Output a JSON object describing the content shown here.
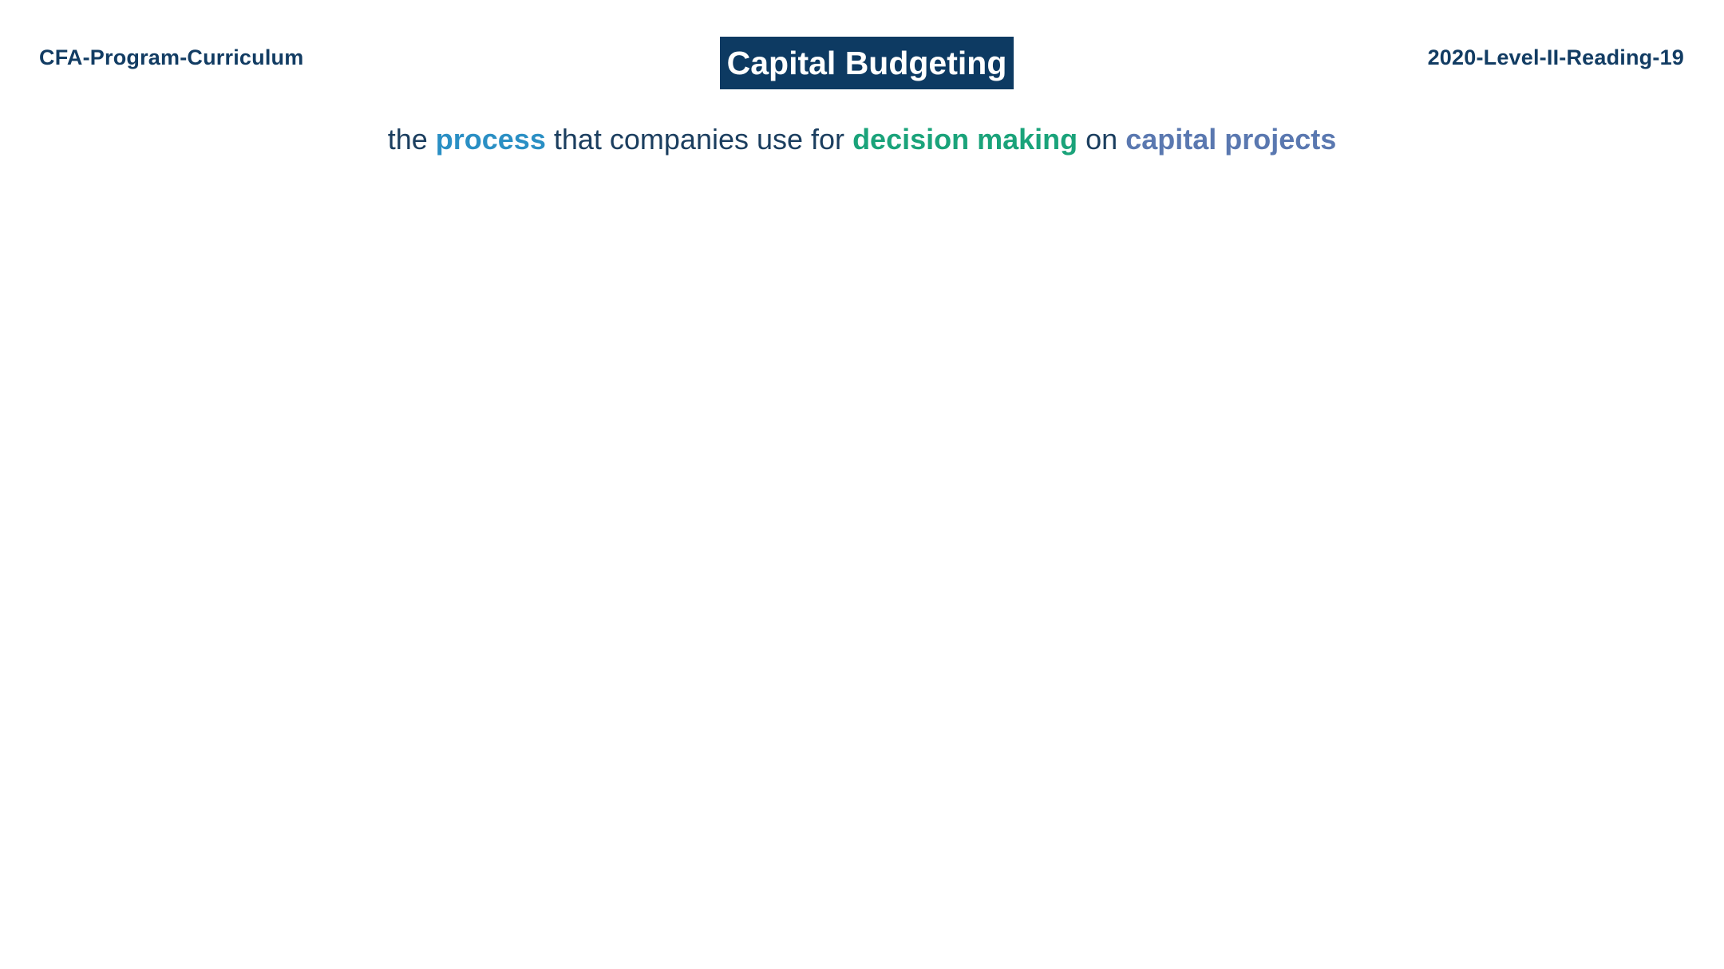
{
  "header": {
    "left_label": "CFA-Program-Curriculum",
    "right_label": "2020-Level-II-Reading-19",
    "title": "Capital Budgeting"
  },
  "definition": {
    "part1": "the ",
    "kw1": "process",
    "part2": " that companies use for ",
    "kw2": "decision making",
    "part3": " on ",
    "kw3": "capital projects"
  },
  "colors": {
    "title_background": "#0d3a62",
    "header_text": "#123c63",
    "process": "#2a8fc4",
    "decision_making": "#1aa37a",
    "capital_projects": "#5a78b0"
  }
}
